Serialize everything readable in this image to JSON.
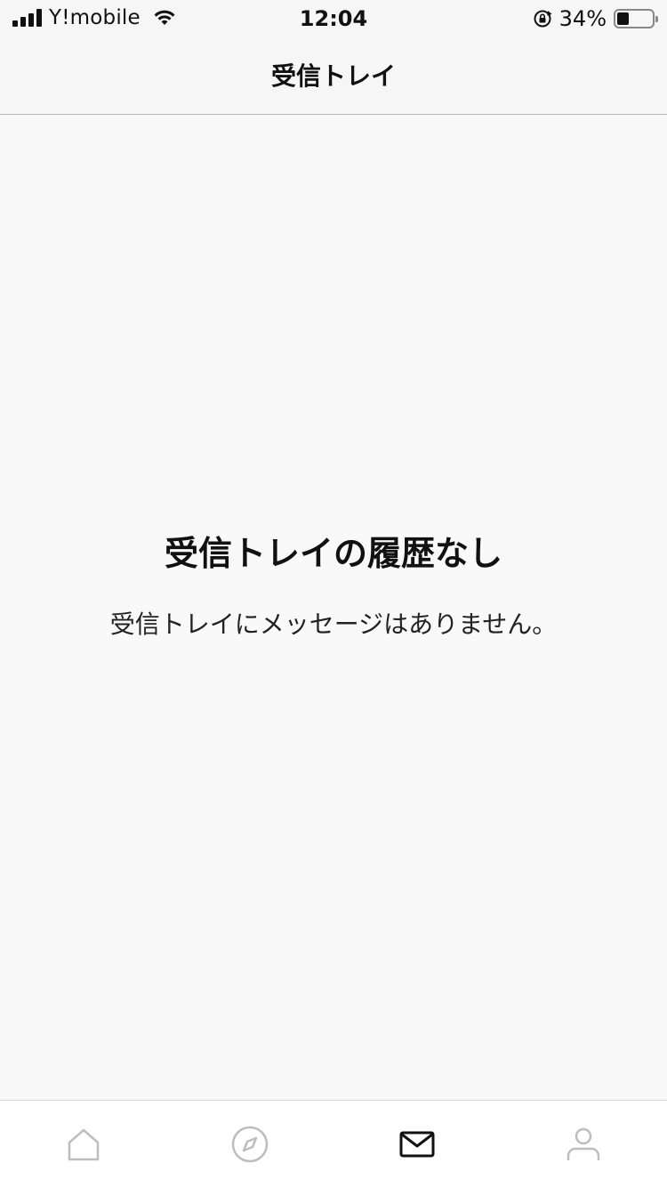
{
  "status_bar": {
    "carrier": "Y!mobile",
    "time": "12:04",
    "battery_percent": "34%",
    "battery_level": 0.34,
    "icons": [
      "signal-icon",
      "wifi-icon",
      "rotation-lock-icon",
      "battery-icon"
    ]
  },
  "header": {
    "title": "受信トレイ"
  },
  "empty_state": {
    "title": "受信トレイの履歴なし",
    "message": "受信トレイにメッセージはありません。"
  },
  "tab_bar": {
    "tabs": [
      {
        "icon": "home-icon",
        "active": false
      },
      {
        "icon": "compass-icon",
        "active": false
      },
      {
        "icon": "mail-icon",
        "active": true
      },
      {
        "icon": "profile-icon",
        "active": false
      }
    ],
    "colors": {
      "active": "#111111",
      "inactive": "#bdbdbd"
    }
  }
}
